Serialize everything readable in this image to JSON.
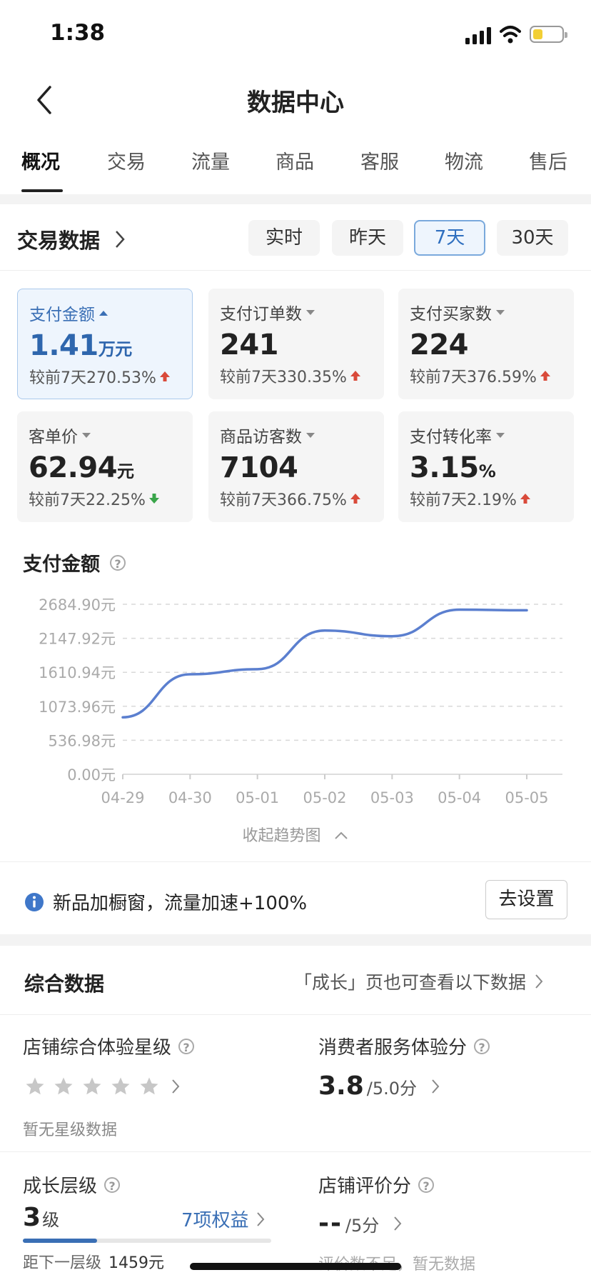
{
  "status_bar": {
    "time": "1:38"
  },
  "header": {
    "title": "数据中心"
  },
  "tabs": [
    "概况",
    "交易",
    "流量",
    "商品",
    "客服",
    "物流",
    "售后"
  ],
  "trade_section": {
    "title": "交易数据",
    "periods": [
      "实时",
      "昨天",
      "7天",
      "30天"
    ],
    "active_period": "7天"
  },
  "metrics": [
    {
      "label": "支付金额",
      "value": "1.41",
      "unit": "万元",
      "compare": "较前7天270.53%",
      "trend": "up",
      "active": true
    },
    {
      "label": "支付订单数",
      "value": "241",
      "unit": "",
      "compare": "较前7天330.35%",
      "trend": "up",
      "active": false
    },
    {
      "label": "支付买家数",
      "value": "224",
      "unit": "",
      "compare": "较前7天376.59%",
      "trend": "up",
      "active": false
    },
    {
      "label": "客单价",
      "value": "62.94",
      "unit": "元",
      "compare": "较前7天22.25%",
      "trend": "down",
      "active": false
    },
    {
      "label": "商品访客数",
      "value": "7104",
      "unit": "",
      "compare": "较前7天366.75%",
      "trend": "up",
      "active": false
    },
    {
      "label": "支付转化率",
      "value": "3.15",
      "unit": "%",
      "compare": "较前7天2.19%",
      "trend": "up",
      "active": false
    }
  ],
  "chart_section": {
    "title": "支付金额",
    "collapse_label": "收起趋势图"
  },
  "chart_data": {
    "type": "line",
    "title": "支付金额",
    "categories": [
      "04-29",
      "04-30",
      "05-01",
      "05-02",
      "05-03",
      "05-04",
      "05-05"
    ],
    "series": [
      {
        "values": [
          900,
          1580,
          1660,
          2270,
          2180,
          2600,
          2590
        ]
      }
    ],
    "yticks": [
      "0.00元",
      "536.98元",
      "1073.96元",
      "1610.94元",
      "2147.92元",
      "2684.90元"
    ],
    "ylim": [
      0,
      2684.9
    ],
    "grid": true,
    "line_color": "#5b7fcf"
  },
  "notice": {
    "text": "新品加橱窗，流量加速+100%",
    "button": "去设置"
  },
  "overall_section": {
    "title": "综合数据",
    "link": "「成长」页也可查看以下数据",
    "store_experience": {
      "label": "店铺综合体验星级",
      "stars": 0,
      "note": "暂无星级数据"
    },
    "service_score": {
      "label": "消费者服务体验分",
      "score": "3.8",
      "out_of": "/5.0分"
    },
    "growth_level": {
      "label": "成长层级",
      "level": "3",
      "unit": "级",
      "benefits": "7项权益",
      "progress": 0.3,
      "next_label": "距下一层级",
      "next_value": "1459元"
    },
    "store_rating": {
      "label": "店铺评价分",
      "score": "--",
      "out_of": "/5分",
      "note": "评价数不足，暂无数据"
    }
  },
  "colors": {
    "accent": "#2e66ad",
    "up": "#d94a3a",
    "down": "#3aa54a"
  }
}
